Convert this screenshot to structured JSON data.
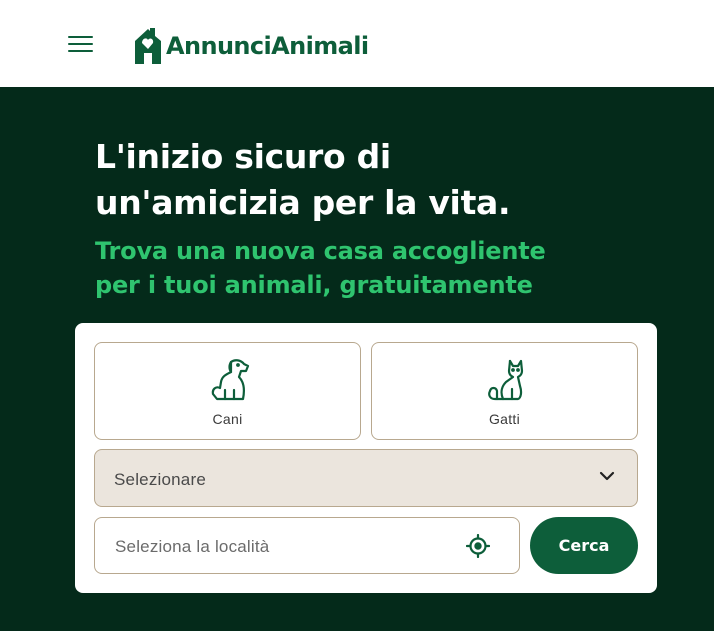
{
  "header": {
    "logo_text": "AnnunciAnimali",
    "menu_icon": "hamburger-menu-icon",
    "logo_icon": "house-logo-icon"
  },
  "hero": {
    "headline_line1": "L'inizio sicuro di",
    "headline_line2": "un'amicizia per la vita.",
    "subline_line1": "Trova una nuova casa accogliente",
    "subline_line2": "per i tuoi animali, gratuitamente"
  },
  "search": {
    "categories": [
      {
        "label": "Cani",
        "icon": "dog-icon"
      },
      {
        "label": "Gatti",
        "icon": "cat-icon"
      }
    ],
    "select_value": "Selezionare",
    "select_icon": "chevron-down-icon",
    "location_placeholder": "Seleziona la località",
    "location_icon": "crosshair-icon",
    "button_label": "Cerca"
  },
  "colors": {
    "brand_green": "#0d5e3a",
    "hero_background": "#042a1a",
    "accent_green": "#2fc46f",
    "select_background": "#ebe5dd",
    "border": "#b8a88f"
  }
}
